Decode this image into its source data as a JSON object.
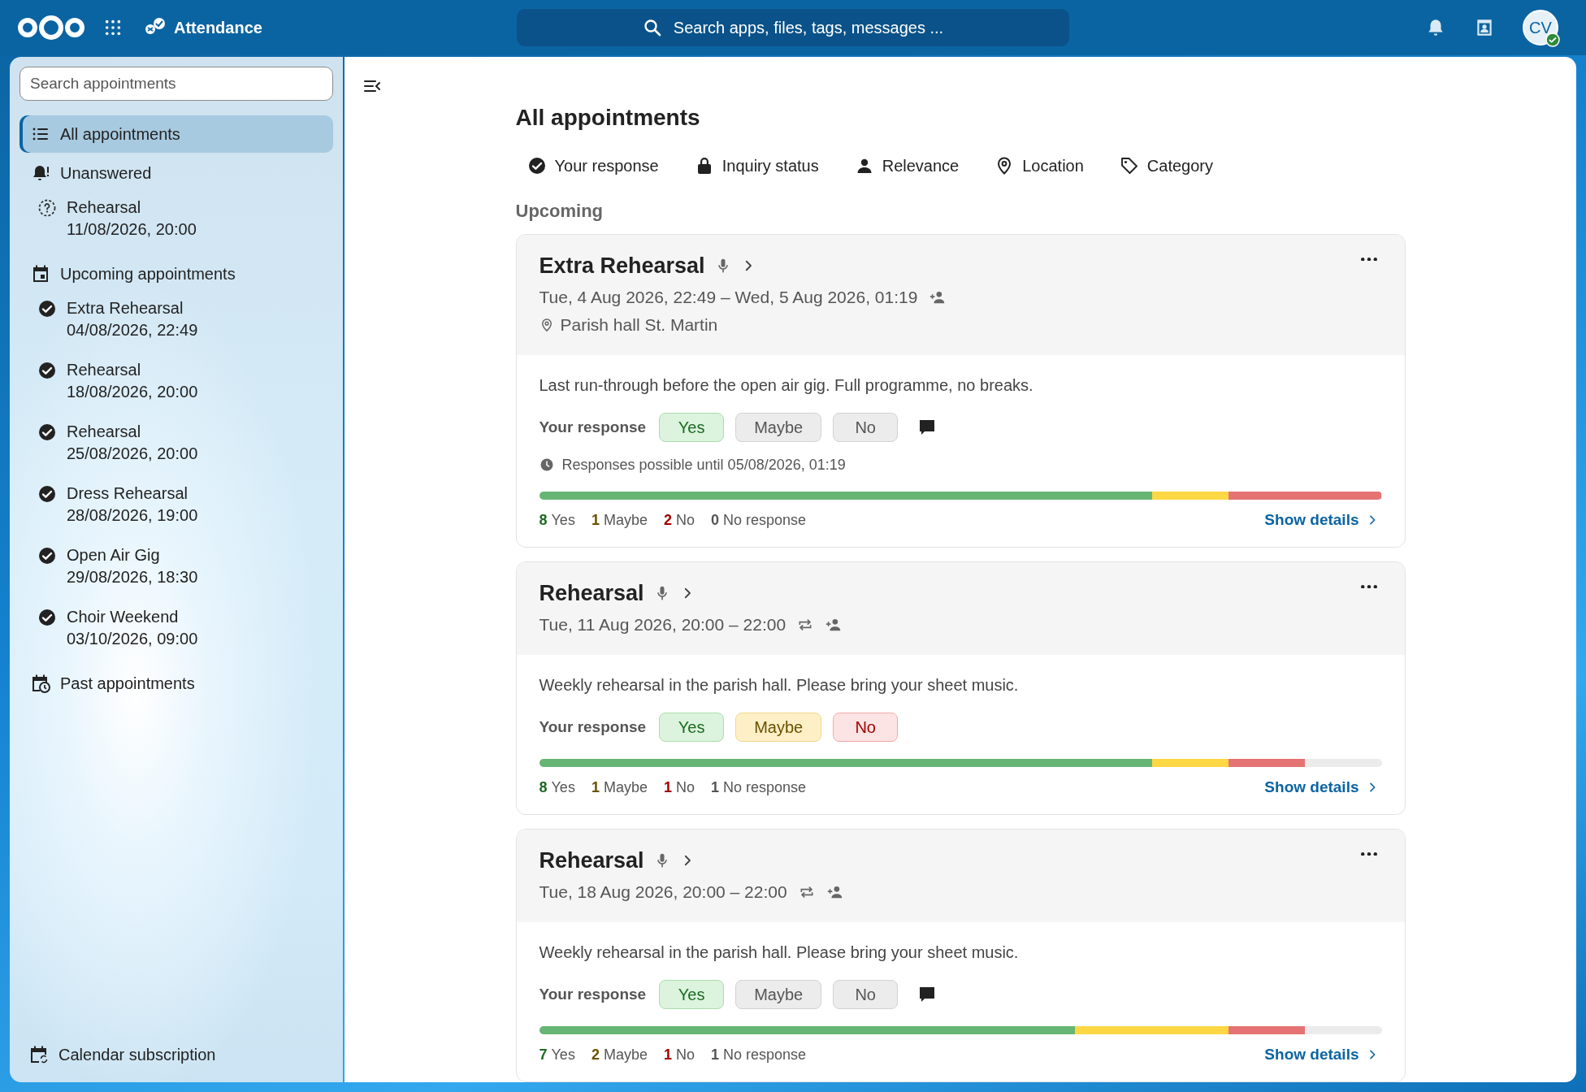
{
  "header": {
    "app_name": "Attendance",
    "search_placeholder": "Search apps, files, tags, messages ...",
    "avatar_initials": "CV"
  },
  "sidebar": {
    "search_placeholder": "Search appointments",
    "items": [
      {
        "label": "All appointments",
        "kind": "list",
        "selected": true
      },
      {
        "label": "Unanswered",
        "kind": "bell",
        "selected": false,
        "children": [
          {
            "title": "Rehearsal",
            "date": "11/08/2026, 20:00",
            "kind": "unanswered"
          }
        ]
      },
      {
        "label": "Upcoming appointments",
        "kind": "calendar",
        "selected": false,
        "children": [
          {
            "title": "Extra Rehearsal",
            "date": "04/08/2026, 22:49",
            "kind": "accepted"
          },
          {
            "title": "Rehearsal",
            "date": "18/08/2026, 20:00",
            "kind": "accepted"
          },
          {
            "title": "Rehearsal",
            "date": "25/08/2026, 20:00",
            "kind": "accepted"
          },
          {
            "title": "Dress Rehearsal",
            "date": "28/08/2026, 19:00",
            "kind": "accepted"
          },
          {
            "title": "Open Air Gig",
            "date": "29/08/2026, 18:30",
            "kind": "accepted"
          },
          {
            "title": "Choir Weekend",
            "date": "03/10/2026, 09:00",
            "kind": "accepted"
          }
        ]
      },
      {
        "label": "Past appointments",
        "kind": "calendar-clock",
        "selected": false
      }
    ],
    "footer": {
      "label": "Calendar subscription"
    }
  },
  "main": {
    "title": "All appointments",
    "filters": [
      {
        "label": "Your response",
        "kind": "check"
      },
      {
        "label": "Inquiry status",
        "kind": "lock"
      },
      {
        "label": "Relevance",
        "kind": "person"
      },
      {
        "label": "Location",
        "kind": "pin"
      },
      {
        "label": "Category",
        "kind": "tag"
      }
    ],
    "section": "Upcoming",
    "cards": [
      {
        "title": "Extra Rehearsal",
        "time": "Tue, 4 Aug 2026, 22:49 – Wed, 5 Aug 2026, 01:19",
        "recurring": false,
        "location": "Parish hall St. Martin",
        "description": "Last run-through before the open air gig. Full programme, no breaks.",
        "response_label": "Your response",
        "options": [
          {
            "label": "Yes",
            "kind": "yes",
            "highlighted": true
          },
          {
            "label": "Maybe",
            "kind": "maybe",
            "highlighted": false
          },
          {
            "label": "No",
            "kind": "no",
            "highlighted": false
          }
        ],
        "comment": true,
        "deadline": "Responses possible until 05/08/2026, 01:19",
        "counts": [
          {
            "count": "8",
            "label": "Yes",
            "kind": "yes"
          },
          {
            "count": "1",
            "label": "Maybe",
            "kind": "maybe"
          },
          {
            "count": "2",
            "label": "No",
            "kind": "no"
          },
          {
            "count": "0",
            "label": "No response",
            "kind": "none"
          }
        ],
        "details": "Show details"
      },
      {
        "title": "Rehearsal",
        "time": "Tue, 11 Aug 2026, 20:00 – 22:00",
        "recurring": true,
        "description": "Weekly rehearsal in the parish hall. Please bring your sheet music.",
        "response_label": "Your response",
        "options": [
          {
            "label": "Yes",
            "kind": "yes",
            "highlighted": true
          },
          {
            "label": "Maybe",
            "kind": "maybe",
            "highlighted": true
          },
          {
            "label": "No",
            "kind": "no",
            "highlighted": true
          }
        ],
        "comment": false,
        "counts": [
          {
            "count": "8",
            "label": "Yes",
            "kind": "yes"
          },
          {
            "count": "1",
            "label": "Maybe",
            "kind": "maybe"
          },
          {
            "count": "1",
            "label": "No",
            "kind": "no"
          },
          {
            "count": "1",
            "label": "No response",
            "kind": "none"
          }
        ],
        "details": "Show details"
      },
      {
        "title": "Rehearsal",
        "time": "Tue, 18 Aug 2026, 20:00 – 22:00",
        "recurring": true,
        "description": "Weekly rehearsal in the parish hall. Please bring your sheet music.",
        "response_label": "Your response",
        "options": [
          {
            "label": "Yes",
            "kind": "yes",
            "highlighted": true
          },
          {
            "label": "Maybe",
            "kind": "maybe",
            "highlighted": false
          },
          {
            "label": "No",
            "kind": "no",
            "highlighted": false
          }
        ],
        "comment": true,
        "counts": [
          {
            "count": "7",
            "label": "Yes",
            "kind": "yes"
          },
          {
            "count": "2",
            "label": "Maybe",
            "kind": "maybe"
          },
          {
            "count": "1",
            "label": "No",
            "kind": "no"
          },
          {
            "count": "1",
            "label": "No response",
            "kind": "none"
          }
        ],
        "details": "Show details"
      }
    ]
  }
}
